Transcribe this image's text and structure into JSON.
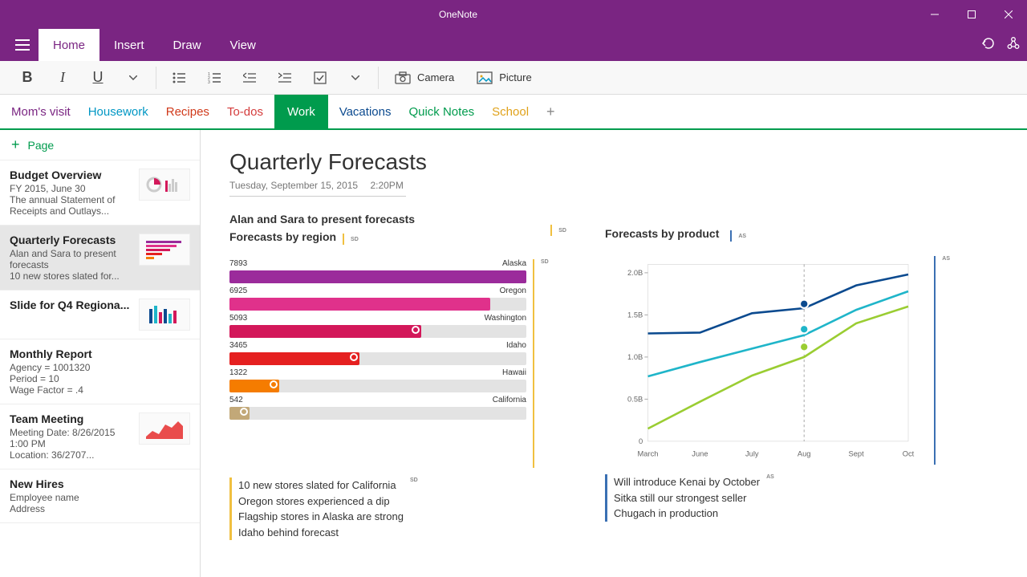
{
  "app": {
    "title": "OneNote"
  },
  "ribbon": {
    "tabs": [
      "Home",
      "Insert",
      "Draw",
      "View"
    ],
    "active": "Home"
  },
  "toolbar": {
    "camera_label": "Camera",
    "picture_label": "Picture"
  },
  "sections": [
    {
      "label": "Mom's visit",
      "color": "#7A2582"
    },
    {
      "label": "Housework",
      "color": "#0097C4"
    },
    {
      "label": "Recipes",
      "color": "#D03A1B"
    },
    {
      "label": "To-dos",
      "color": "#D43C3C"
    },
    {
      "label": "Work",
      "color": "#009B4D",
      "active": true
    },
    {
      "label": "Vacations",
      "color": "#0B4A8F"
    },
    {
      "label": "Quick Notes",
      "color": "#009B4D"
    },
    {
      "label": "School",
      "color": "#E0A21B"
    }
  ],
  "pagelist": {
    "newpage_label": "Page",
    "items": [
      {
        "title": "Budget Overview",
        "preview": "FY 2015, June 30\nThe annual Statement of Receipts and Outlays..."
      },
      {
        "title": "Quarterly Forecasts",
        "preview": "Alan and Sara to present forecasts\n10 new stores slated for...",
        "selected": true
      },
      {
        "title": "Slide for Q4 Regiona...",
        "preview": ""
      },
      {
        "title": "Monthly Report",
        "preview": "Agency = 1001320\nPeriod = 10\nWage Factor = .4"
      },
      {
        "title": "Team Meeting",
        "preview": "Meeting Date: 8/26/2015\n1:00 PM\nLocation: 36/2707..."
      },
      {
        "title": "New Hires",
        "preview": "Employee name\nAddress"
      }
    ]
  },
  "page": {
    "title": "Quarterly Forecasts",
    "date": "Tuesday, September 15, 2015",
    "time": "2:20PM",
    "header_line1": "Alan and Sara to present forecasts",
    "header_line2": "Forecasts by region",
    "header_badge1": "SD",
    "badge2": "SD",
    "product_header": "Forecasts by product",
    "product_badge": "AS",
    "notes_left": [
      "10 new stores slated for California",
      "Oregon stores experienced a dip",
      "Flagship stores in Alaska are strong",
      "Idaho behind forecast"
    ],
    "notes_left_badge": "SD",
    "notes_right": [
      "Will introduce Kenai by October",
      "Sitka still our strongest seller",
      "Chugach in production"
    ],
    "notes_right_badge": "AS"
  },
  "chart_data": [
    {
      "type": "bar",
      "title": "Forecasts by region",
      "x_max": 7893,
      "series": [
        {
          "label": "Alaska",
          "value": 7893,
          "color": "#9B2B9B"
        },
        {
          "label": "Oregon",
          "value": 6925,
          "color": "#E0318B"
        },
        {
          "label": "Washington",
          "value": 5093,
          "color": "#D3185A"
        },
        {
          "label": "Idaho",
          "value": 3465,
          "color": "#E52020"
        },
        {
          "label": "Hawaii",
          "value": 1322,
          "color": "#F57C00"
        },
        {
          "label": "California",
          "value": 542,
          "color": "#C2A878"
        }
      ]
    },
    {
      "type": "line",
      "title": "Forecasts by product",
      "xlabel": "",
      "ylabel": "",
      "ylim": [
        0,
        2.1
      ],
      "categories": [
        "March",
        "June",
        "July",
        "Aug",
        "Sept",
        "Oct"
      ],
      "marker_x": "Aug",
      "series": [
        {
          "name": "Sitka",
          "color": "#0B4A8F",
          "values": [
            1.28,
            1.29,
            1.52,
            1.58,
            1.85,
            1.98
          ],
          "marker": 1.63
        },
        {
          "name": "Kenai",
          "color": "#1FB5C9",
          "values": [
            0.77,
            0.94,
            1.1,
            1.26,
            1.56,
            1.78
          ],
          "marker": 1.33
        },
        {
          "name": "Chugach",
          "color": "#9ACD32",
          "values": [
            0.15,
            0.47,
            0.78,
            1.0,
            1.4,
            1.6
          ],
          "marker": 1.12
        }
      ],
      "yticks": [
        0,
        "0.5B",
        "1.0B",
        "1.5B",
        "2.0B"
      ]
    }
  ]
}
